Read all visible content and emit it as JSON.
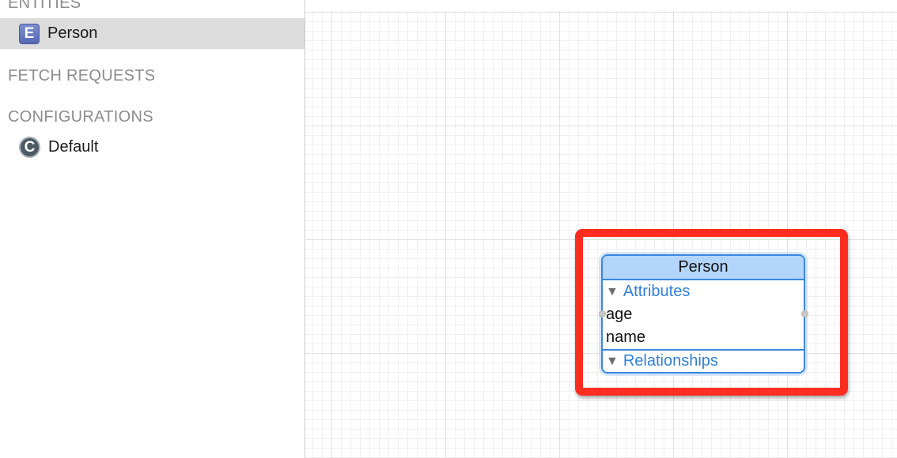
{
  "sidebar": {
    "entities_header": "ENTITIES",
    "entities": [
      {
        "icon_letter": "E",
        "icon": "entity-icon",
        "label": "Person",
        "selected": true
      }
    ],
    "fetch_requests_header": "FETCH REQUESTS",
    "configurations_header": "CONFIGURATIONS",
    "configurations": [
      {
        "icon_letter": "C",
        "icon": "configuration-icon",
        "label": "Default"
      }
    ]
  },
  "graph": {
    "entity": {
      "title": "Person",
      "attributes_label": "Attributes",
      "attributes": [
        "age",
        "name"
      ],
      "relationships_label": "Relationships",
      "disclosure_glyph": "▼"
    }
  },
  "colors": {
    "selection_bg": "#dcdcdc",
    "entity_header_bg": "#b3d5fb",
    "entity_border": "#3c86e0",
    "section_text": "#2f7fdb",
    "highlight": "#fe2d20",
    "sidebar_header_text": "#8c8c8c"
  }
}
